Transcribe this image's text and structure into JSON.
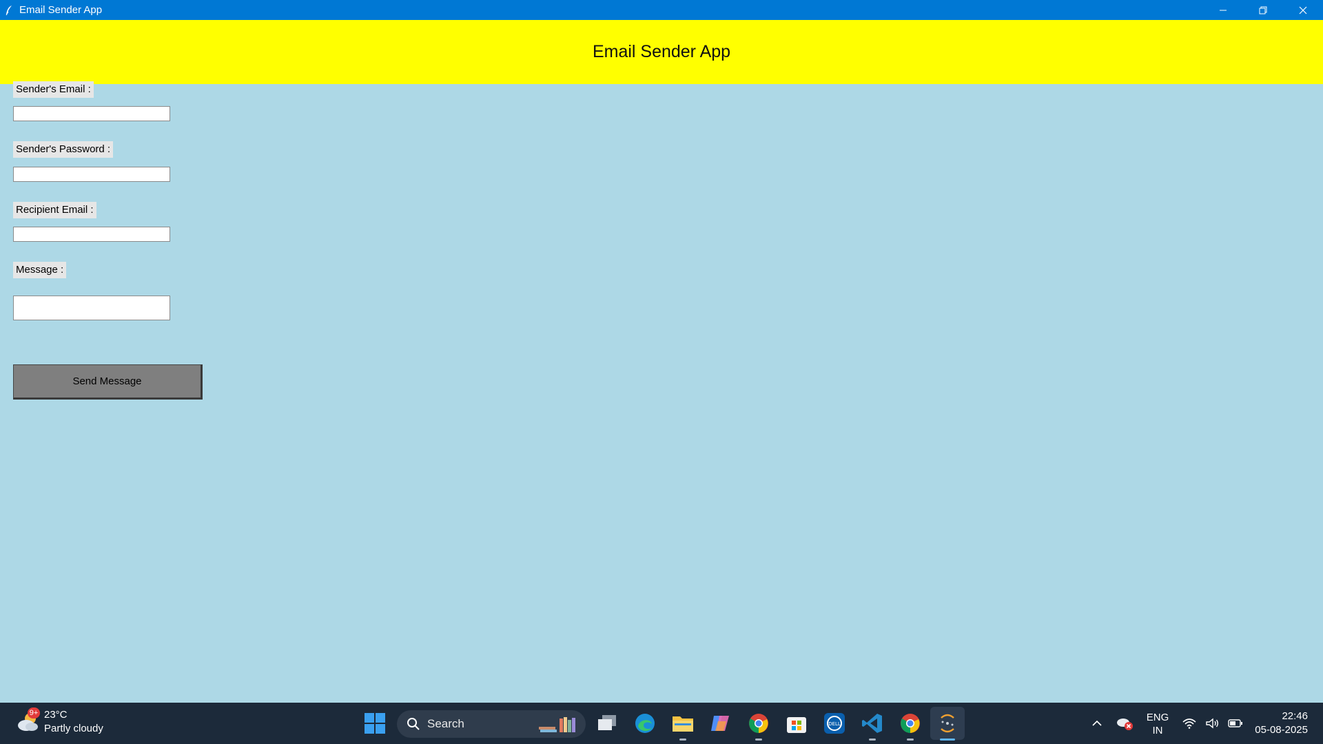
{
  "window": {
    "title": "Email Sender App",
    "controls": [
      "minimize-icon",
      "restore-icon",
      "close-icon"
    ]
  },
  "app": {
    "header": "Email Sender App",
    "fields": {
      "sender_email_label": "Sender's Email :",
      "sender_password_label": "Sender's Password :",
      "recipient_email_label": "Recipient Email :",
      "message_label": "Message :"
    },
    "inputs": {
      "sender_email_value": "",
      "sender_password_value": "",
      "recipient_email_value": "",
      "message_value": ""
    },
    "send_button_label": "Send Message",
    "colors": {
      "background": "#add8e6",
      "header_bg": "#ffff00",
      "button_bg": "#7f7f7f",
      "titlebar": "#0078d4"
    }
  },
  "taskbar": {
    "weather": {
      "temp": "23°C",
      "condition": "Partly cloudy",
      "badge": "9+"
    },
    "search": {
      "label": "Search"
    },
    "pinned": [
      "windows-start-icon",
      "task-view-icon",
      "edge-icon",
      "file-explorer-icon",
      "copilot-icon",
      "chrome-icon",
      "microsoft-store-icon",
      "dell-icon",
      "vscode-icon",
      "chrome-icon",
      "python-tk-icon"
    ],
    "tray": {
      "lang_top": "ENG",
      "lang_bottom": "IN",
      "time": "22:46",
      "date": "05-08-2025"
    }
  }
}
